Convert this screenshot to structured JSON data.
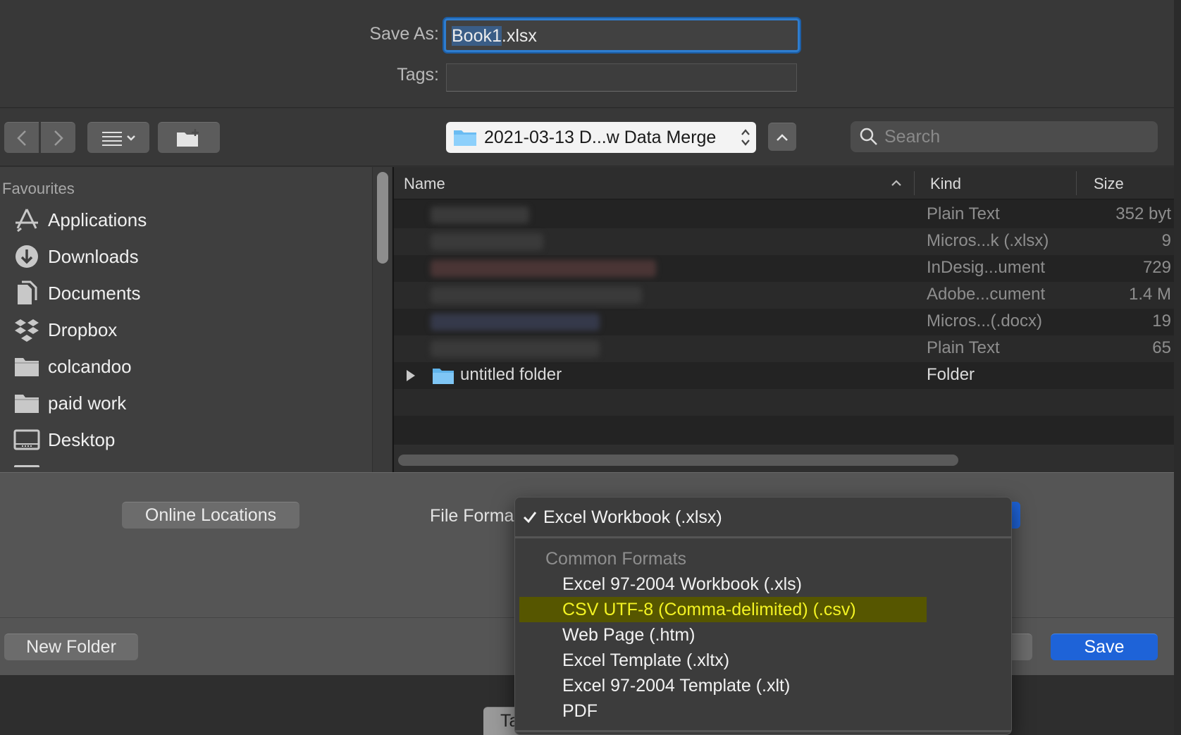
{
  "form": {
    "saveas_label": "Save As:",
    "filename_selected": "Book1",
    "filename_rest": ".xlsx",
    "tags_label": "Tags:"
  },
  "toolbar": {
    "path_folder": "2021-03-13 D...w Data Merge",
    "search_placeholder": "Search"
  },
  "sidebar": {
    "section": "Favourites",
    "items": [
      {
        "label": "Applications",
        "icon": "applications-icon"
      },
      {
        "label": "Downloads",
        "icon": "downloads-icon"
      },
      {
        "label": "Documents",
        "icon": "documents-icon"
      },
      {
        "label": "Dropbox",
        "icon": "dropbox-icon"
      },
      {
        "label": "colcandoo",
        "icon": "folder-icon"
      },
      {
        "label": "paid work",
        "icon": "folder-icon"
      },
      {
        "label": "Desktop",
        "icon": "desktop-icon"
      }
    ]
  },
  "filelist": {
    "columns": {
      "name": "Name",
      "kind": "Kind",
      "size": "Size"
    },
    "rows": [
      {
        "kind": "Plain Text",
        "size": "352 byt"
      },
      {
        "kind": "Micros...k (.xlsx)",
        "size": "9"
      },
      {
        "kind": "InDesig...ument",
        "size": "729"
      },
      {
        "kind": "Adobe...cument",
        "size": "1.4 M"
      },
      {
        "kind": "Micros...(.docx)",
        "size": "19"
      },
      {
        "kind": "Plain Text",
        "size": "65"
      }
    ],
    "folder": {
      "name": "untitled folder",
      "kind": "Folder"
    }
  },
  "bottom": {
    "online_locations": "Online Locations",
    "file_format_label": "File Forma",
    "new_folder": "New Folder",
    "save": "Save",
    "behind_tab": "Ta"
  },
  "menu": {
    "checked": "Excel Workbook (.xlsx)",
    "section": "Common Formats",
    "items": [
      "Excel 97-2004 Workbook (.xls)",
      "CSV UTF-8 (Comma-delimited) (.csv)",
      "Web Page (.htm)",
      "Excel Template (.xltx)",
      "Excel 97-2004 Template (.xlt)",
      "PDF"
    ],
    "highlight_color": "#f3f322"
  }
}
